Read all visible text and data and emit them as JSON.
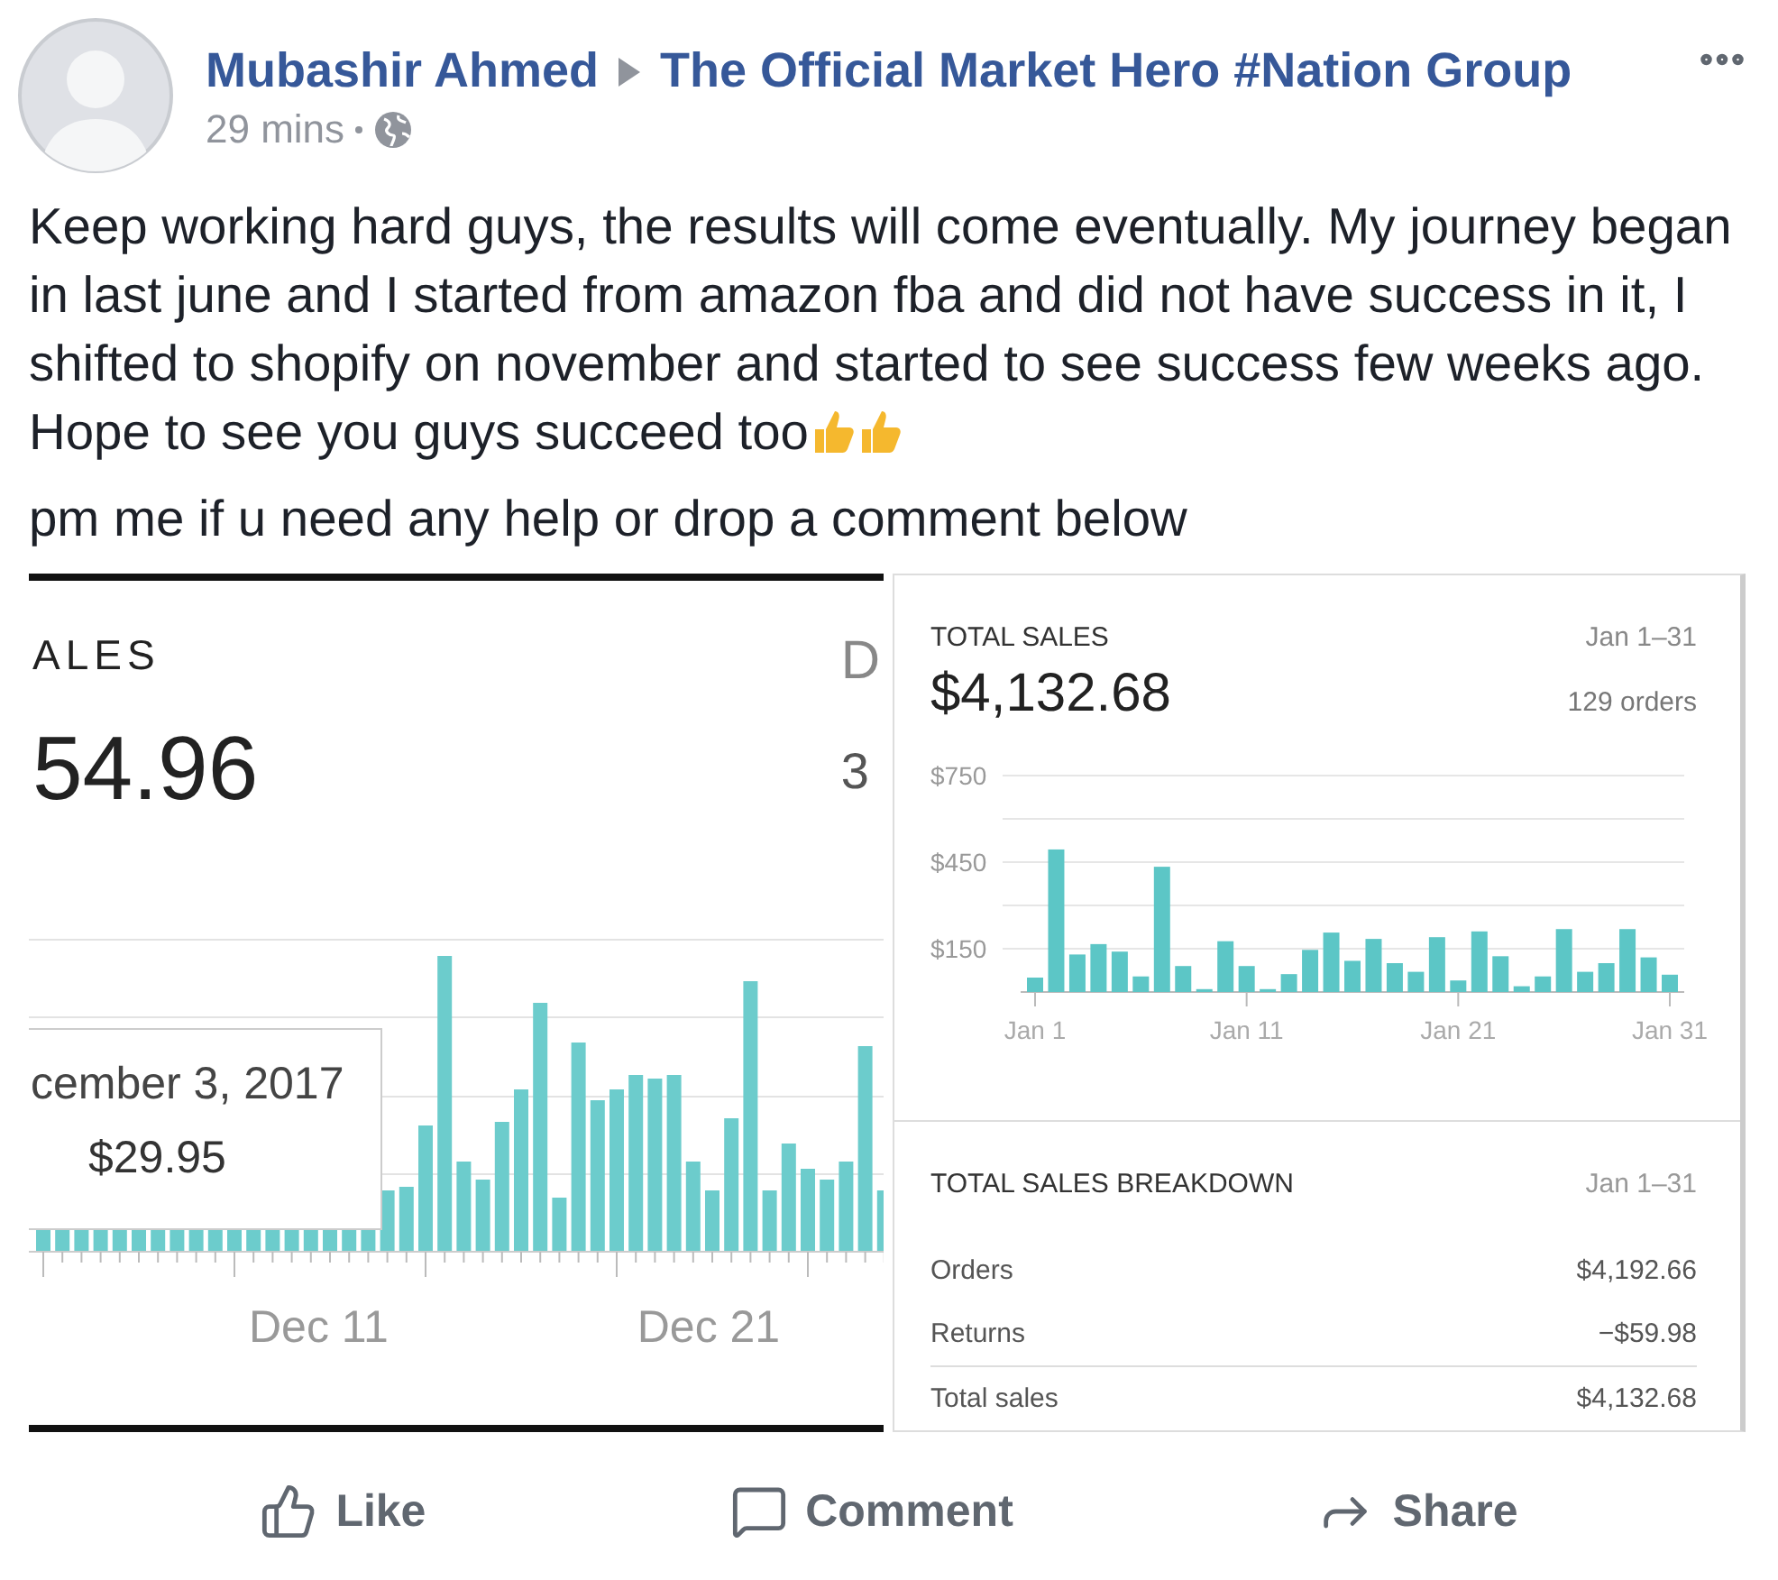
{
  "post": {
    "author": "Mubashir Ahmed",
    "group": "The Official Market Hero #Nation Group",
    "time": "29 mins",
    "paragraphs": [
      "Keep working hard guys, the results will come eventually. My journey began in last june and I started from amazon fba and did not have success in it, I shifted to shopify on november and started to see success few weeks ago. Hope to see you guys succeed too",
      "pm me if u need any help or drop a comment below"
    ]
  },
  "left_image": {
    "title": "ALES",
    "amount": "54.96",
    "side_title": "D",
    "side_value": "3",
    "tooltip": {
      "date": "cember 3, 2017",
      "value": "$29.95"
    },
    "x_labels": [
      "Dec 11",
      "Dec 21"
    ]
  },
  "right_image": {
    "title": "TOTAL SALES",
    "range": "Jan 1–31",
    "amount": "$4,132.68",
    "orders": "129 orders",
    "chart_data": {
      "type": "bar",
      "categories": [
        "Jan 1",
        null,
        null,
        null,
        null,
        null,
        null,
        null,
        null,
        null,
        "Jan 11",
        null,
        null,
        null,
        null,
        null,
        null,
        null,
        null,
        null,
        "Jan 21",
        null,
        null,
        null,
        null,
        null,
        null,
        null,
        null,
        null,
        "Jan 31"
      ],
      "series": [
        {
          "color": "#5cc6c6",
          "values": [
            50,
            494,
            130,
            166,
            140,
            54,
            434,
            90,
            10,
            176,
            90,
            10,
            62,
            146,
            206,
            108,
            184,
            100,
            70,
            190,
            40,
            210,
            124,
            20,
            54,
            218,
            70,
            100,
            218,
            120,
            60
          ]
        }
      ],
      "ylim": [
        0,
        750
      ],
      "yticks": [
        {
          "value": 150,
          "label": "$150"
        },
        {
          "value": 450,
          "label": "$450"
        },
        {
          "value": 750,
          "label": "$750"
        }
      ]
    },
    "breakdown": {
      "title": "TOTAL SALES BREAKDOWN",
      "range": "Jan 1–31",
      "rows": [
        {
          "label": "Orders",
          "value": "$4,192.66"
        },
        {
          "label": "Returns",
          "value": "−$59.98"
        },
        {
          "label": "Total sales",
          "value": "$4,132.68"
        }
      ]
    }
  },
  "actions": [
    {
      "kind": "like",
      "label": "Like"
    },
    {
      "kind": "comment",
      "label": "Comment"
    },
    {
      "kind": "share",
      "label": "Share"
    }
  ]
}
